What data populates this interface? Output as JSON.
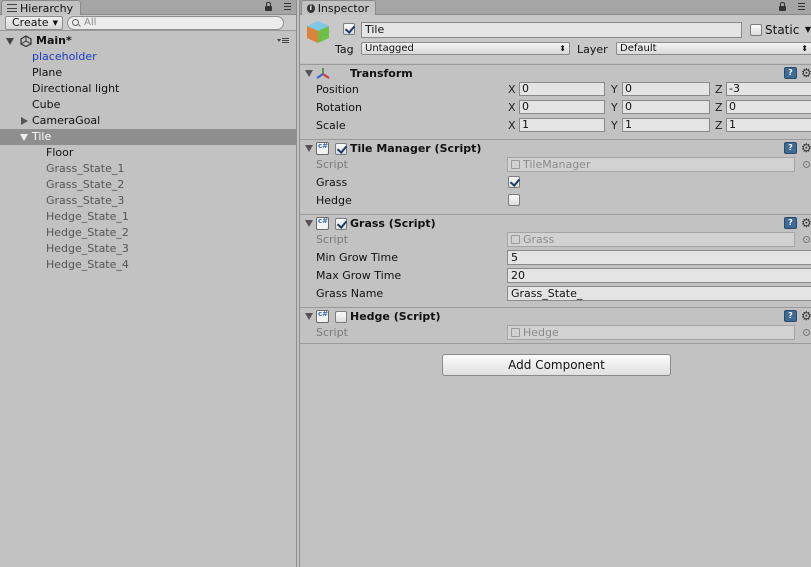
{
  "hierarchy": {
    "tab_label": "Hierarchy",
    "create_label": "Create",
    "search_placeholder": "All",
    "scene_name": "Main*",
    "items": [
      {
        "label": "placeholder",
        "style": "prefab"
      },
      {
        "label": "Plane",
        "style": "normal"
      },
      {
        "label": "Directional light",
        "style": "normal"
      },
      {
        "label": "Cube",
        "style": "normal"
      },
      {
        "label": "CameraGoal",
        "style": "normal",
        "expandable": true
      },
      {
        "label": "Tile",
        "style": "selected",
        "expanded": true
      },
      {
        "label": "Floor",
        "style": "normal",
        "child": true
      },
      {
        "label": "Grass_State_1",
        "style": "inactive",
        "child": true
      },
      {
        "label": "Grass_State_2",
        "style": "inactive",
        "child": true
      },
      {
        "label": "Grass_State_3",
        "style": "inactive",
        "child": true
      },
      {
        "label": "Hedge_State_1",
        "style": "inactive",
        "child": true
      },
      {
        "label": "Hedge_State_2",
        "style": "inactive",
        "child": true
      },
      {
        "label": "Hedge_State_3",
        "style": "inactive",
        "child": true
      },
      {
        "label": "Hedge_State_4",
        "style": "inactive",
        "child": true
      }
    ]
  },
  "inspector": {
    "tab_label": "Inspector",
    "object_name": "Tile",
    "active": true,
    "static_label": "Static",
    "static_checked": false,
    "tag_label": "Tag",
    "tag_value": "Untagged",
    "layer_label": "Layer",
    "layer_value": "Default",
    "transform": {
      "title": "Transform",
      "position_label": "Position",
      "rotation_label": "Rotation",
      "scale_label": "Scale",
      "axis_x": "X",
      "axis_y": "Y",
      "axis_z": "Z",
      "position": {
        "x": "0",
        "y": "0",
        "z": "-3"
      },
      "rotation": {
        "x": "0",
        "y": "0",
        "z": "0"
      },
      "scale": {
        "x": "1",
        "y": "1",
        "z": "1"
      }
    },
    "tile_manager": {
      "title": "Tile Manager (Script)",
      "enabled": true,
      "script_label": "Script",
      "script_value": "TileManager",
      "grass_label": "Grass",
      "grass_checked": true,
      "hedge_label": "Hedge",
      "hedge_checked": false
    },
    "grass": {
      "title": "Grass (Script)",
      "enabled": true,
      "script_label": "Script",
      "script_value": "Grass",
      "min_grow_label": "Min Grow Time",
      "min_grow_value": "5",
      "max_grow_label": "Max Grow Time",
      "max_grow_value": "20",
      "grass_name_label": "Grass Name",
      "grass_name_value": "Grass_State_"
    },
    "hedge": {
      "title": "Hedge (Script)",
      "enabled": false,
      "script_label": "Script",
      "script_value": "Hedge"
    },
    "add_component_label": "Add Component"
  },
  "icons": {
    "lock": "lock-icon",
    "menu": "panel-menu-icon",
    "help": "help-icon",
    "gear": "gear-icon",
    "script": "csharp-script-icon",
    "cube": "gameobject-cube-icon",
    "transform": "transform-axes-icon"
  },
  "colors": {
    "panel_bg": "#c2c2c2",
    "selection": "#8e8e8e",
    "prefab_text": "#1a3bc7",
    "inactive_text": "#555555"
  }
}
